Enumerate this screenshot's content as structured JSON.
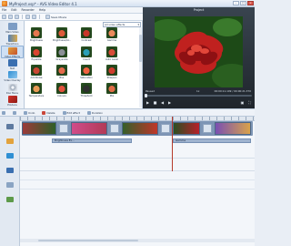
{
  "window": {
    "title": "MyProject.vsp* - AVS Video Editor 4.1",
    "minimize": "–",
    "maximize": "□",
    "close": "×"
  },
  "menu": [
    "File",
    "Edit",
    "Recorder",
    "Help"
  ],
  "toolbar": {
    "save_movie_label": "Save Movie"
  },
  "sidebar": {
    "items": [
      {
        "label": "Main Video",
        "icon": "home-icon"
      },
      {
        "label": "Transitions",
        "icon": "transitions-icon"
      },
      {
        "label": "Video Effects",
        "icon": "video-effects-icon"
      },
      {
        "label": "Text",
        "icon": "text-icon"
      },
      {
        "label": "Video Overlay",
        "icon": "video-overlay-icon"
      },
      {
        "label": "Disc Menu",
        "icon": "disc-menu-icon"
      },
      {
        "label": "Produce",
        "icon": "produce-icon"
      }
    ]
  },
  "effects": {
    "filter": "All video effects",
    "items": [
      {
        "label": "Brightness",
        "color": "#e6774f"
      },
      {
        "label": "Brightness/Co..",
        "color": "#dd5a3a"
      },
      {
        "label": "Contrast",
        "color": "#c9362a"
      },
      {
        "label": "Gamma",
        "color": "#ec8a5c"
      },
      {
        "label": "Equalize",
        "color": "#d9442f"
      },
      {
        "label": "Grayscale",
        "color": "#8a8f96"
      },
      {
        "label": "Invert",
        "color": "#2a9fb7"
      },
      {
        "label": "Auto Level",
        "color": "#d84c38"
      },
      {
        "label": "Add Noise",
        "color": "#c94733"
      },
      {
        "label": "Blur",
        "color": "#e46a4a"
      },
      {
        "label": "Saturation",
        "color": "#f0613f"
      },
      {
        "label": "Sharpen",
        "color": "#cf3d2d"
      },
      {
        "label": "Temperature",
        "color": "#e89a55"
      },
      {
        "label": "Colours",
        "color": "#e2523c"
      },
      {
        "label": "Threshold",
        "color": "#2f2f2f"
      },
      {
        "label": "Mix",
        "color": "#e06d46"
      }
    ]
  },
  "preview": {
    "title": "Project",
    "status_label": "Paused",
    "zoom": "1x",
    "time_current": "00:00:11.109",
    "time_total": "00:00:21.370"
  },
  "timeline_toolbar": {
    "tools": [
      "Undo",
      "Delete",
      "Edit effect",
      "Duration"
    ]
  },
  "timeline": {
    "effect_bars": [
      {
        "label": "Brightness Ex..."
      },
      {
        "label": "Gamma"
      }
    ]
  }
}
